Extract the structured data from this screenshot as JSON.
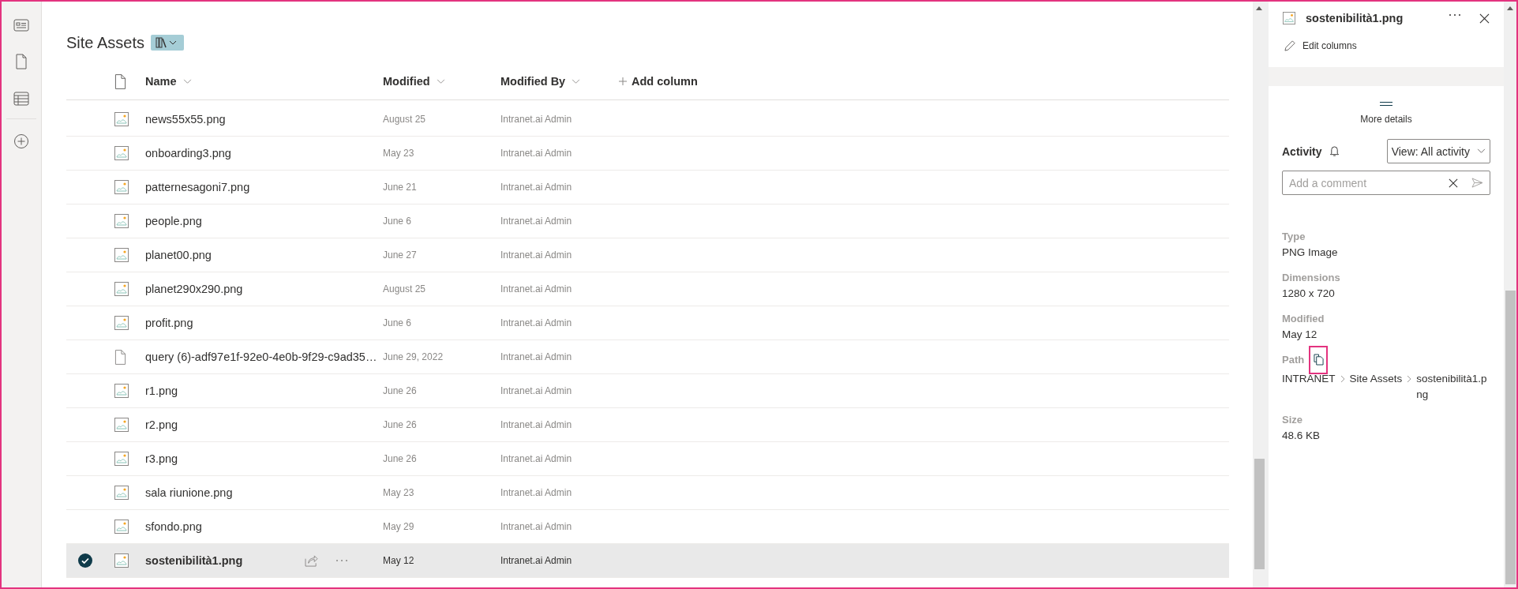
{
  "library": {
    "title": "Site Assets"
  },
  "columns": [
    {
      "label": "Name"
    },
    {
      "label": "Modified"
    },
    {
      "label": "Modified By"
    }
  ],
  "add_column": "Add column",
  "rows": [
    {
      "name": "news55x55.png",
      "kind": "image",
      "modified": "August 25",
      "modified_by": "Intranet.ai Admin",
      "selected": false
    },
    {
      "name": "onboarding3.png",
      "kind": "image",
      "modified": "May 23",
      "modified_by": "Intranet.ai Admin",
      "selected": false
    },
    {
      "name": "patternesagoni7.png",
      "kind": "image",
      "modified": "June 21",
      "modified_by": "Intranet.ai Admin",
      "selected": false
    },
    {
      "name": "people.png",
      "kind": "image",
      "modified": "June 6",
      "modified_by": "Intranet.ai Admin",
      "selected": false
    },
    {
      "name": "planet00.png",
      "kind": "image",
      "modified": "June 27",
      "modified_by": "Intranet.ai Admin",
      "selected": false
    },
    {
      "name": "planet290x290.png",
      "kind": "image",
      "modified": "August 25",
      "modified_by": "Intranet.ai Admin",
      "selected": false
    },
    {
      "name": "profit.png",
      "kind": "image",
      "modified": "June 6",
      "modified_by": "Intranet.ai Admin",
      "selected": false
    },
    {
      "name": "query (6)-adf97e1f-92e0-4e0b-9f29-c9ad35…",
      "kind": "file",
      "modified": "June 29, 2022",
      "modified_by": "Intranet.ai Admin",
      "selected": false
    },
    {
      "name": "r1.png",
      "kind": "image",
      "modified": "June 26",
      "modified_by": "Intranet.ai Admin",
      "selected": false
    },
    {
      "name": "r2.png",
      "kind": "image",
      "modified": "June 26",
      "modified_by": "Intranet.ai Admin",
      "selected": false
    },
    {
      "name": "r3.png",
      "kind": "image",
      "modified": "June 26",
      "modified_by": "Intranet.ai Admin",
      "selected": false
    },
    {
      "name": "sala riunione.png",
      "kind": "image",
      "modified": "May 23",
      "modified_by": "Intranet.ai Admin",
      "selected": false
    },
    {
      "name": "sfondo.png",
      "kind": "image",
      "modified": "May 29",
      "modified_by": "Intranet.ai Admin",
      "selected": false
    },
    {
      "name": "sostenibilità1.png",
      "kind": "image",
      "modified": "May 12",
      "modified_by": "Intranet.ai Admin",
      "selected": true
    }
  ],
  "details": {
    "file_name": "sostenibilità1.png",
    "edit_columns": "Edit columns",
    "more_details": "More details",
    "activity": {
      "label": "Activity",
      "view": "View: All activity",
      "comment_placeholder": "Add a comment"
    },
    "properties": [
      {
        "label": "Type",
        "kind": "text",
        "value": "PNG Image"
      },
      {
        "label": "Dimensions",
        "kind": "text",
        "value": "1280 x 720"
      },
      {
        "label": "Modified",
        "kind": "text",
        "value": "May 12"
      },
      {
        "label": "Path",
        "kind": "path",
        "segments": [
          "INTRANET",
          "Site Assets",
          "sostenibilità1.png"
        ]
      },
      {
        "label": "Size",
        "kind": "text",
        "value": "48.6 KB"
      }
    ]
  }
}
